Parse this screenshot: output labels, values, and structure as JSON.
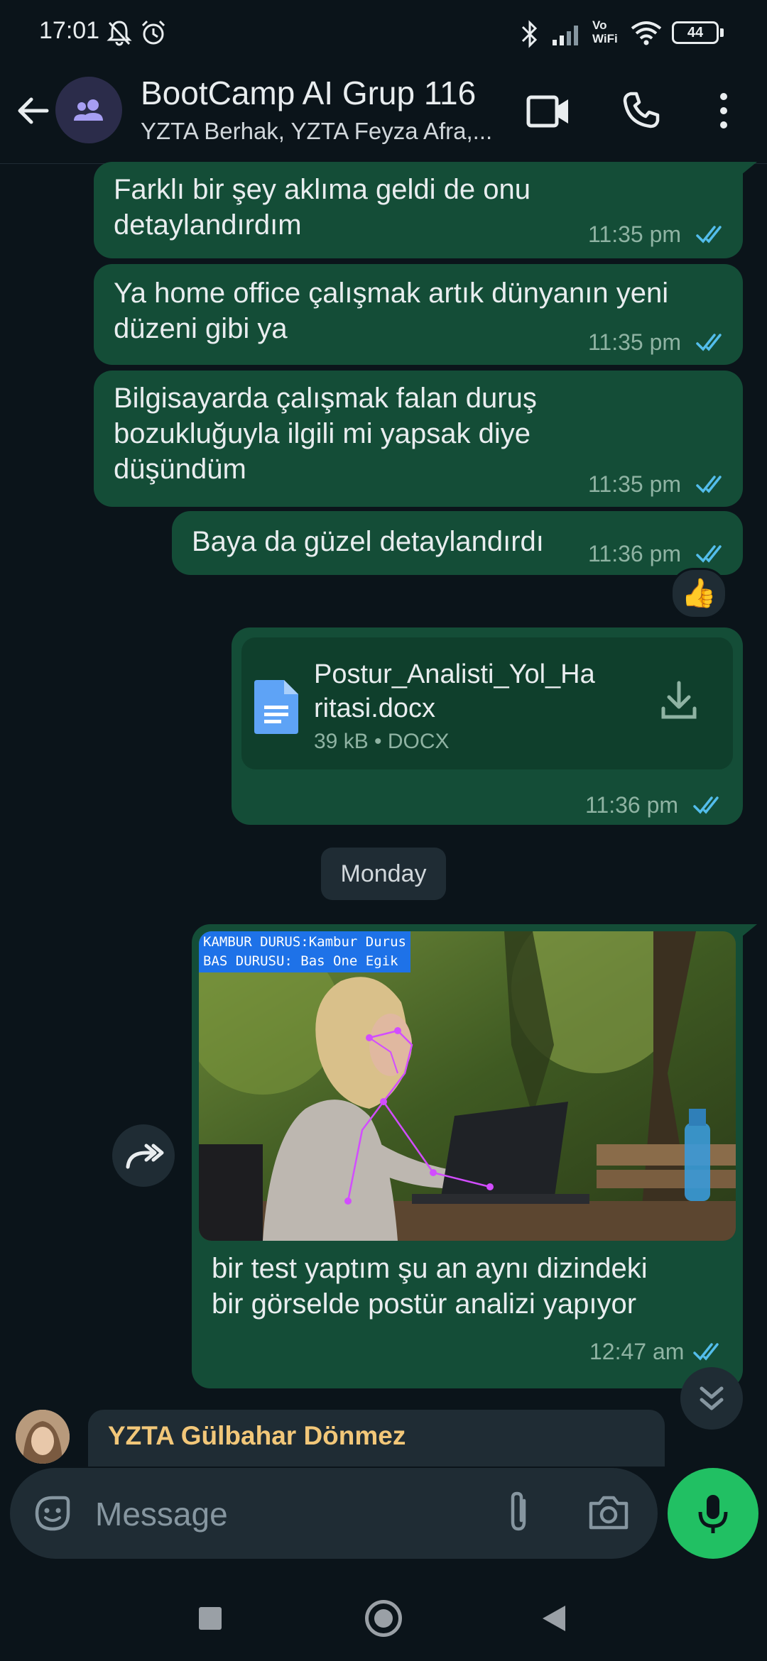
{
  "status_bar": {
    "time": "17:01",
    "battery": "44",
    "network": "Vo WiFi"
  },
  "header": {
    "title": "BootCamp AI Grup 116",
    "subtitle": "YZTA Berhak, YZTA Feyza Afra,...",
    "icons": [
      "back-arrow-icon",
      "group-avatar-icon",
      "video-call-icon",
      "voice-call-icon",
      "more-vert-icon"
    ]
  },
  "messages": [
    {
      "text": "Farklı bir şey aklıma geldi de onu detaylandırdım",
      "lines": [
        "Farklı bir şey aklıma geldi de onu",
        "detaylandırdım"
      ],
      "time": "11:35 pm"
    },
    {
      "text": "Ya home office çalışmak artık dünyanın yeni düzeni gibi ya",
      "lines": [
        "Ya home office çalışmak artık dünyanın yeni",
        "düzeni gibi ya"
      ],
      "time": "11:35 pm"
    },
    {
      "text": "Bilgisayarda çalışmak falan duruş bozukluğuyla ilgili mi yapsak diye düşündüm",
      "lines": [
        "Bilgisayarda çalışmak falan duruş",
        "bozukluğuyla ilgili mi yapsak diye",
        "düşündüm"
      ],
      "time": "11:35 pm"
    },
    {
      "text": "Baya da güzel detaylandırdı",
      "lines": [
        "Baya da güzel detaylandırdı"
      ],
      "time": "11:36 pm",
      "reaction": "👍"
    }
  ],
  "document": {
    "name_lines": [
      "Postur_Analisti_Yol_Ha",
      "ritasi.docx"
    ],
    "meta": "39 kB • DOCX",
    "time": "11:36 pm"
  },
  "day_divider": "Monday",
  "image_message": {
    "overlay": {
      "line1_label": "KAMBUR DURUS:",
      "line1_value": "Kambur Durus",
      "line2_label": "BAS DURUSU:",
      "line2_value": "Bas One Egik"
    },
    "caption_lines": [
      "bir test yaptım şu an aynı dizindeki",
      "bir görselde postür analizi yapıyor"
    ],
    "time": "12:47 am"
  },
  "reply_preview": {
    "sender": "YZTA Gülbahar Dönmez"
  },
  "composer": {
    "placeholder": "Message"
  },
  "colors": {
    "bubble": "#144d37",
    "accent_green": "#21c063",
    "tick_blue": "#53bdeb",
    "sender_name": "#f2c779",
    "background": "#0b141a"
  }
}
